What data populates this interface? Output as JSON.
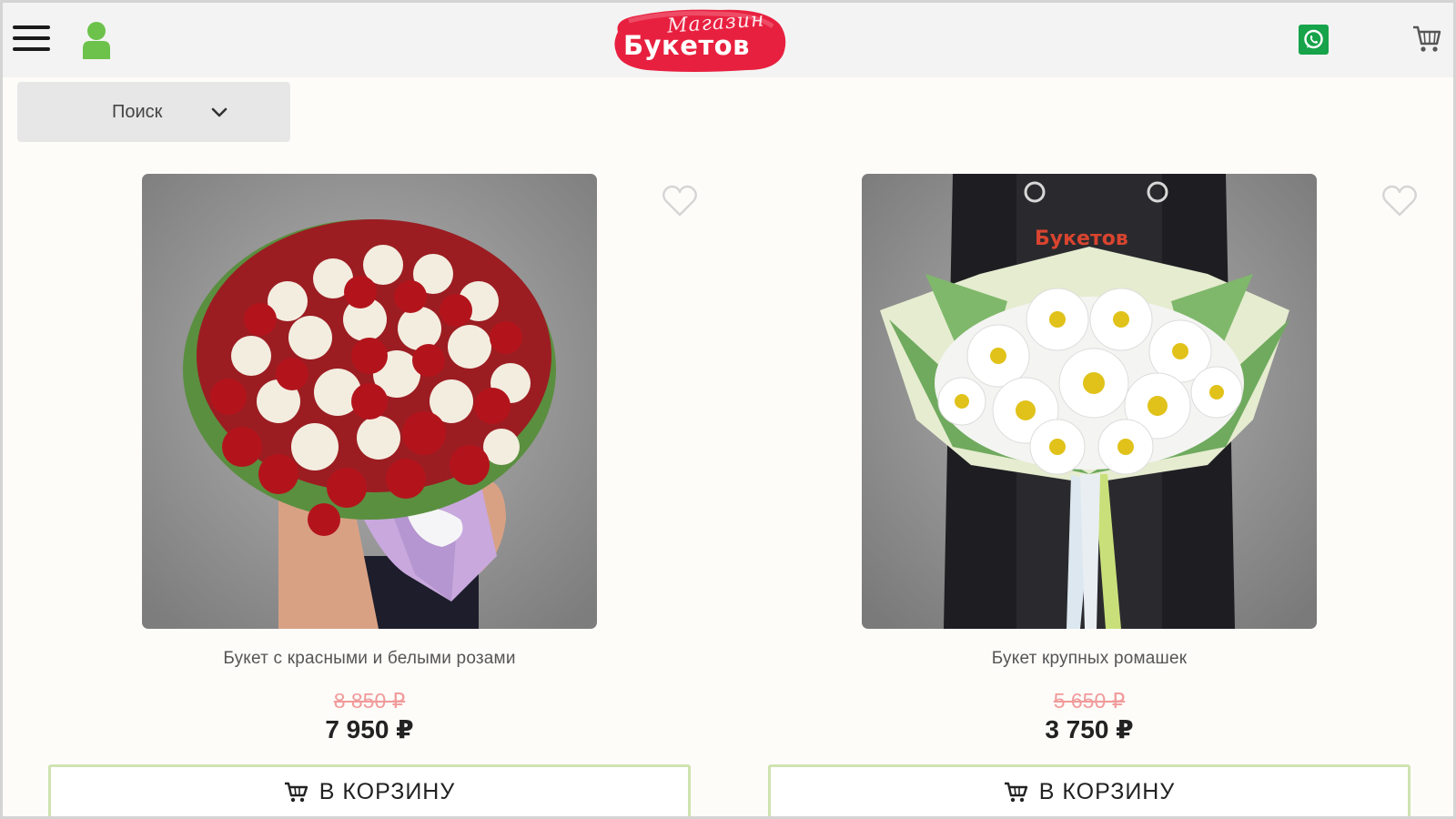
{
  "header": {
    "logo": {
      "script": "Магазин",
      "text": "Букетов"
    }
  },
  "search": {
    "label": "Поиск"
  },
  "products": [
    {
      "name": "Букет с красными и белыми розами",
      "old_price": "8 850 ₽",
      "new_price": "7 950 ₽",
      "cart_label": "В КОРЗИНУ"
    },
    {
      "name": "Букет крупных ромашек",
      "old_price": "5 650 ₽",
      "new_price": "3 750 ₽",
      "cart_label": "В КОРЗИНУ"
    }
  ],
  "colors": {
    "accent": "#e01b3c",
    "user_icon": "#6cc24a",
    "whatsapp": "#16a34a",
    "old_price": "#f19a9a",
    "button_border": "#cfe3b0"
  }
}
